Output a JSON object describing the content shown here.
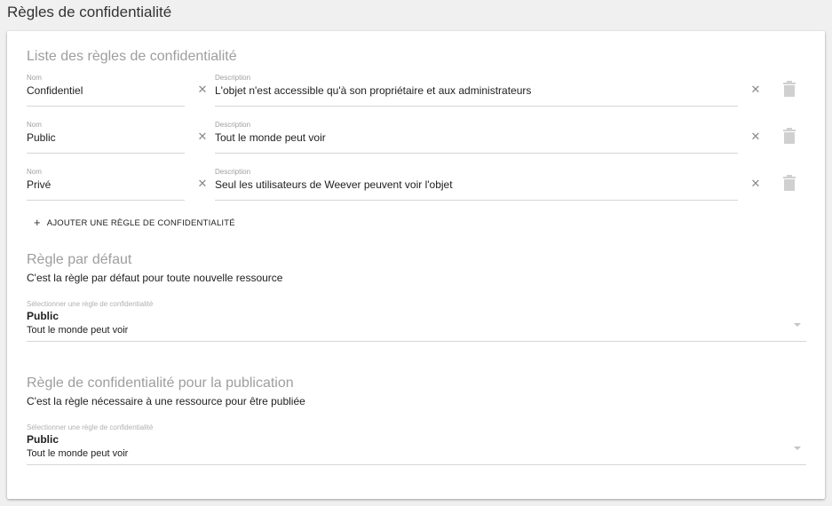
{
  "page": {
    "title": "Règles de confidentialité"
  },
  "rules_section": {
    "title": "Liste des règles de confidentialité",
    "name_label": "Nom",
    "description_label": "Description",
    "clear_icon": "close-icon",
    "delete_icon": "trash-icon",
    "rules": [
      {
        "name": "Confidentiel",
        "description": "L'objet n'est accessible qu'à son propriétaire et aux administrateurs"
      },
      {
        "name": "Public",
        "description": "Tout le monde peut voir"
      },
      {
        "name": "Privé",
        "description": "Seul les utilisateurs de Weever peuvent voir l'objet"
      }
    ],
    "add_button_label": "AJOUTER UNE RÈGLE DE CONFIDENTIALITÉ"
  },
  "default_rule": {
    "title": "Règle par défaut",
    "description": "C'est la règle par défaut pour toute nouvelle ressource",
    "select_label": "Sélectionner une règle de confidentialité",
    "selected_name": "Public",
    "selected_description": "Tout le monde peut voir"
  },
  "publication_rule": {
    "title": "Règle de confidentialité pour la publication",
    "description": "C'est la règle nécessaire à une ressource pour être publiée",
    "select_label": "Sélectionner une règle de confidentialité",
    "selected_name": "Public",
    "selected_description": "Tout le monde peut voir"
  },
  "colors": {
    "section_title": "#9e9e9e",
    "icon": "#8a8a8a",
    "trash_icon": "#d0d0d0",
    "underline": "#d6d6d6"
  }
}
